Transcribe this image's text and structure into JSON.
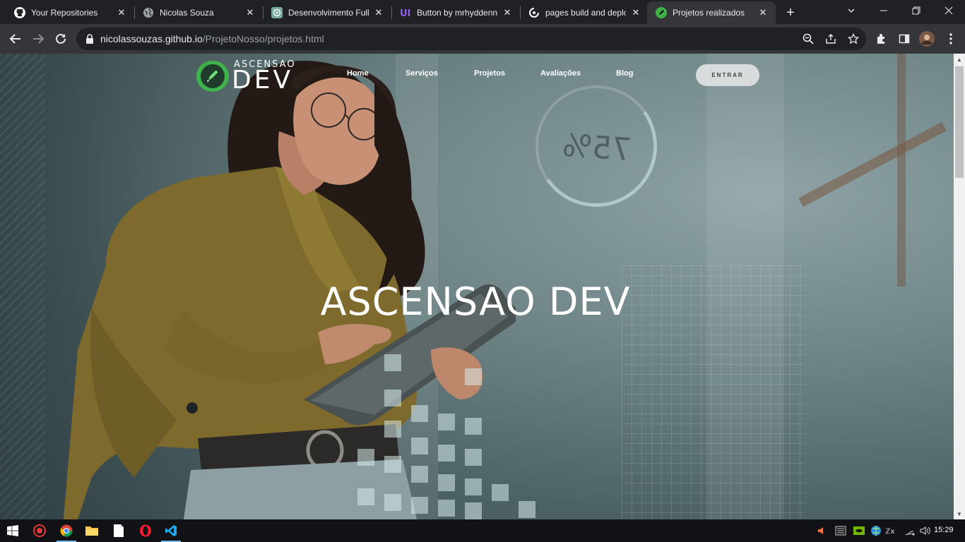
{
  "tabs": [
    {
      "title": "Your Repositories",
      "icon": "github-icon",
      "active": false
    },
    {
      "title": "Nicolas Souza",
      "icon": "globe-icon",
      "active": false
    },
    {
      "title": "Desenvolvimento Full",
      "icon": "openai-icon",
      "active": false
    },
    {
      "title": "Button by mrhyddenn",
      "icon": "uiverse-icon",
      "active": false
    },
    {
      "title": "pages build and deplo",
      "icon": "github-actions-icon",
      "active": false
    },
    {
      "title": "Projetos realizados",
      "icon": "rocket-icon",
      "active": true
    }
  ],
  "address": {
    "host": "nicolassouzas.github.io",
    "path": "/ProjetoNosso/projetos.html"
  },
  "site": {
    "logo_top": "ASCENSAO",
    "logo_bottom": "DEV",
    "nav": [
      "Home",
      "Serviços",
      "Projetos",
      "Avaliações",
      "Blog"
    ],
    "login_button": "ENTRAR",
    "hero_title": "ASCENSAO DEV",
    "background_gauge_text": "75%"
  },
  "taskbar": {
    "apps": [
      "windows-start-icon",
      "screen-recorder-icon",
      "chrome-icon",
      "file-explorer-icon",
      "notepad-icon",
      "opera-icon",
      "vscode-icon"
    ],
    "clock": "15:29"
  },
  "colors": {
    "accent_green": "#3fb24a",
    "chrome_dark": "#202124",
    "chrome_toolbar": "#35363a"
  }
}
